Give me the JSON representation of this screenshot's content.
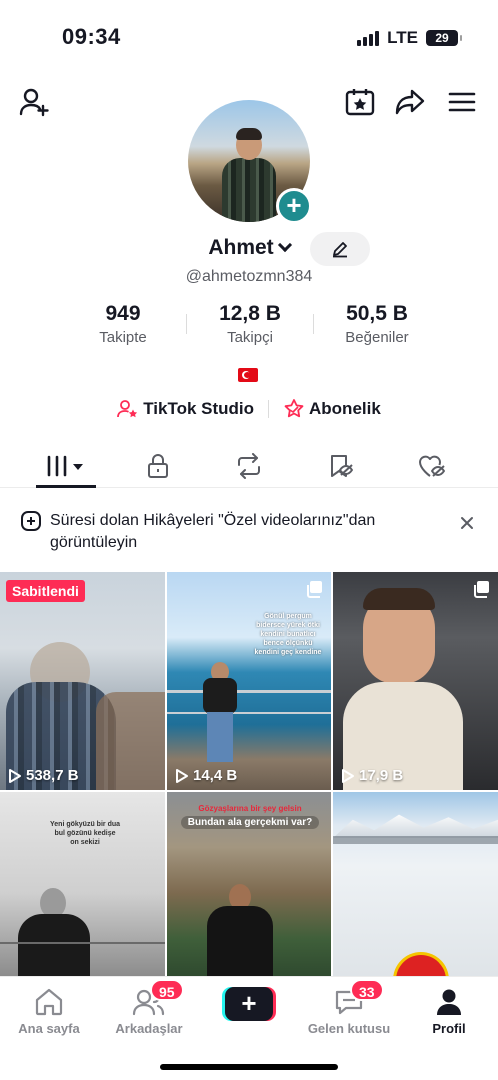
{
  "status_bar": {
    "time": "09:34",
    "network": "LTE",
    "battery": "29"
  },
  "profile": {
    "name": "Ahmet",
    "handle": "@ahmetozmn384",
    "stats": [
      {
        "value": "949",
        "label": "Takipte"
      },
      {
        "value": "12,8 B",
        "label": "Takipçi"
      },
      {
        "value": "50,5 B",
        "label": "Beğeniler"
      }
    ],
    "links": {
      "studio": "TikTok Studio",
      "subscription": "Abonelik"
    }
  },
  "notice": {
    "text": "Süresi dolan Hikâyeleri \"Özel videolarınız\"dan görüntüleyin"
  },
  "videos": [
    {
      "badge": "Sabitlendi",
      "views": "538,7 B"
    },
    {
      "views": "14,4 B",
      "overlay": "Gönül pergum bidersce yürek ötki kendini bunatlıcı bence ölçünkü kendini geç kendine"
    },
    {
      "views": "17,9 B"
    },
    {
      "overlay": "Yeni gökyüzü bir dua bul gözünü kedişe on sekizi"
    },
    {
      "caption_red": "Gözyaşlarına bir şey gelsin",
      "caption": "Bundan ala gerçekmi var?"
    },
    {}
  ],
  "bottom_nav": [
    {
      "label": "Ana sayfa"
    },
    {
      "label": "Arkadaşlar",
      "badge": "95"
    },
    {
      "label": "Gelen kutusu",
      "badge": "33"
    },
    {
      "label": "Profil"
    }
  ],
  "colors": {
    "accent": "#fe2c55",
    "teal": "#1f8c8f",
    "cyan": "#25f4ee",
    "text": "#161823",
    "secondary": "#5a5c63"
  }
}
